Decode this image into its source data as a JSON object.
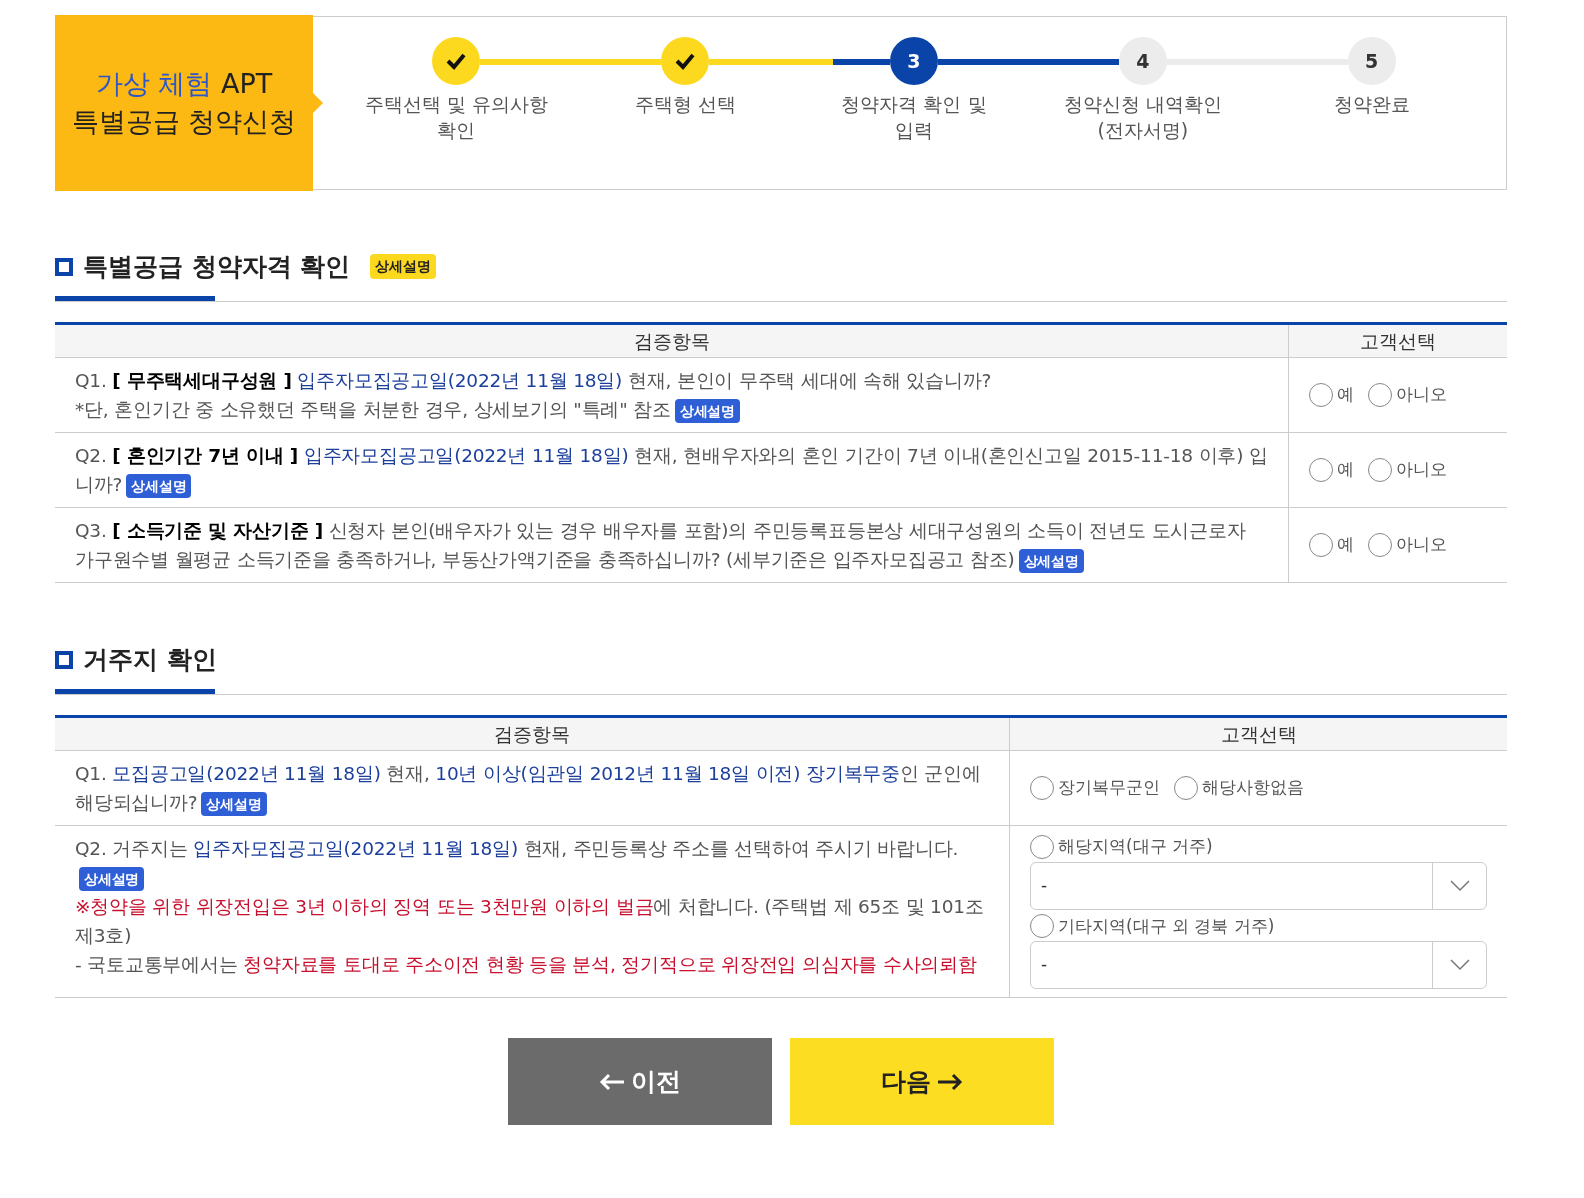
{
  "header": {
    "title_highlight": "가상 체험",
    "title_rest": "APT",
    "subtitle": "특별공급 청약신청"
  },
  "steps": [
    {
      "label": [
        "주택선택 및 유의사항",
        "확인"
      ],
      "completed": true,
      "selected": false
    },
    {
      "label": [
        "주택형 선택"
      ],
      "completed": true,
      "selected": false
    },
    {
      "number": "3",
      "label": [
        "청약자격 확인 및",
        "입력"
      ],
      "completed": false,
      "selected": true
    },
    {
      "number": "4",
      "label": [
        "청약신청 내역확인",
        "(전자서명)"
      ],
      "completed": false,
      "selected": false
    },
    {
      "number": "5",
      "label": [
        "청약완료"
      ],
      "completed": false,
      "selected": false
    }
  ],
  "sections": [
    {
      "title": "특별공급 청약자격 확인",
      "title_badge": "상세설명",
      "columns": [
        "검증항목",
        "고객선택"
      ],
      "rows": [
        {
          "lines": [
            [
              {
                "kind": "plain",
                "text": "Q1. "
              },
              {
                "kind": "bold",
                "text": "[ 무주택세대구성원 ]"
              },
              {
                "kind": "blue",
                "text": " 입주자모집공고일(2022년 11월 18일)"
              },
              {
                "kind": "plain",
                "text": " 현재, 본인이 무주택 세대에 속해 있습니까?"
              }
            ],
            [
              {
                "kind": "plain",
                "text": "*단, 혼인기간 중 소유했던 주택을 처분한 경우, 상세보기의 \"특례\" 참조"
              },
              {
                "kind": "badge",
                "text": "상세설명"
              }
            ]
          ],
          "choices": [
            {
              "kind": "radio",
              "label": "예",
              "selected": false
            },
            {
              "kind": "radio",
              "label": "아니오",
              "selected": false
            }
          ]
        },
        {
          "lines": [
            [
              {
                "kind": "plain",
                "text": "Q2. "
              },
              {
                "kind": "bold",
                "text": "[ 혼인기간 7년 이내 ]"
              },
              {
                "kind": "blue",
                "text": " 입주자모집공고일(2022년 11월 18일)"
              },
              {
                "kind": "plain",
                "text": " 현재, 현배우자와의 혼인 기간이 7년 이내(혼인신고일 2015-11-18 이후) 입니까?"
              },
              {
                "kind": "badge",
                "text": "상세설명"
              }
            ]
          ],
          "choices": [
            {
              "kind": "radio",
              "label": "예",
              "selected": false
            },
            {
              "kind": "radio",
              "label": "아니오",
              "selected": false
            }
          ]
        },
        {
          "lines": [
            [
              {
                "kind": "plain",
                "text": "Q3. "
              },
              {
                "kind": "bold",
                "text": "[ 소득기준 및 자산기준 ]"
              },
              {
                "kind": "plain",
                "text": " 신청자 본인(배우자가 있는 경우 배우자를 포함)의 주민등록표등본상 세대구성원의 소득이 전년도 도시근로자 가구원수별 월평균 소득기준을 충족하거나, 부동산가액기준을 충족하십니까? (세부기준은 입주자모집공고 참조)"
              },
              {
                "kind": "badge",
                "text": "상세설명"
              }
            ]
          ],
          "choices": [
            {
              "kind": "radio",
              "label": "예",
              "selected": false
            },
            {
              "kind": "radio",
              "label": "아니오",
              "selected": false
            }
          ]
        }
      ]
    },
    {
      "title": "거주지 확인",
      "columns": [
        "검증항목",
        "고객선택"
      ],
      "rows": [
        {
          "lines": [
            [
              {
                "kind": "plain",
                "text": "Q1. "
              },
              {
                "kind": "blue",
                "text": "모집공고일(2022년 11월 18일)"
              },
              {
                "kind": "plain",
                "text": " 현재, "
              },
              {
                "kind": "blue",
                "text": "10년 이상(임관일 2012년 11월 18일 이전) 장기복무중"
              },
              {
                "kind": "plain",
                "text": "인 군인에 해당되십니까?"
              },
              {
                "kind": "badge",
                "text": "상세설명"
              }
            ]
          ],
          "choices": [
            {
              "kind": "radio",
              "label": "장기복무군인",
              "selected": false
            },
            {
              "kind": "radio",
              "label": "해당사항없음",
              "selected": false
            }
          ]
        },
        {
          "lines": [
            [
              {
                "kind": "plain",
                "text": "Q2. 거주지는 "
              },
              {
                "kind": "blue",
                "text": "입주자모집공고일(2022년 11월 18일)"
              },
              {
                "kind": "plain",
                "text": " 현재, 주민등록상 주소를 선택하여 주시기 바랍니다."
              },
              {
                "kind": "badge",
                "text": "상세설명"
              }
            ]
          ],
          "notes": [
            [
              {
                "kind": "red",
                "text": "※청약을 위한 위장전입은 3년 이하의 징역 또는 3천만원 이하의 벌금"
              },
              {
                "kind": "plain",
                "text": "에 처합니다. (주택법 제 65조 및 101조 제3호)"
              }
            ],
            [
              {
                "kind": "plain",
                "text": "- 국토교통부에서는 "
              },
              {
                "kind": "red",
                "text": "청약자료를 토대로 주소이전 현황 등을 분석, 정기적으로 위장전입 의심자를 수사의뢰함"
              }
            ]
          ],
          "choices": [
            {
              "kind": "radio-select",
              "label": "해당지역(대구 거주)",
              "selected": false,
              "value": "-"
            },
            {
              "kind": "radio-select",
              "label": "기타지역(대구 외 경북 거주)",
              "selected": false,
              "value": "-"
            }
          ]
        }
      ]
    }
  ],
  "buttons": [
    {
      "kind": "prev",
      "label": "이전"
    },
    {
      "kind": "next",
      "label": "다음"
    }
  ]
}
